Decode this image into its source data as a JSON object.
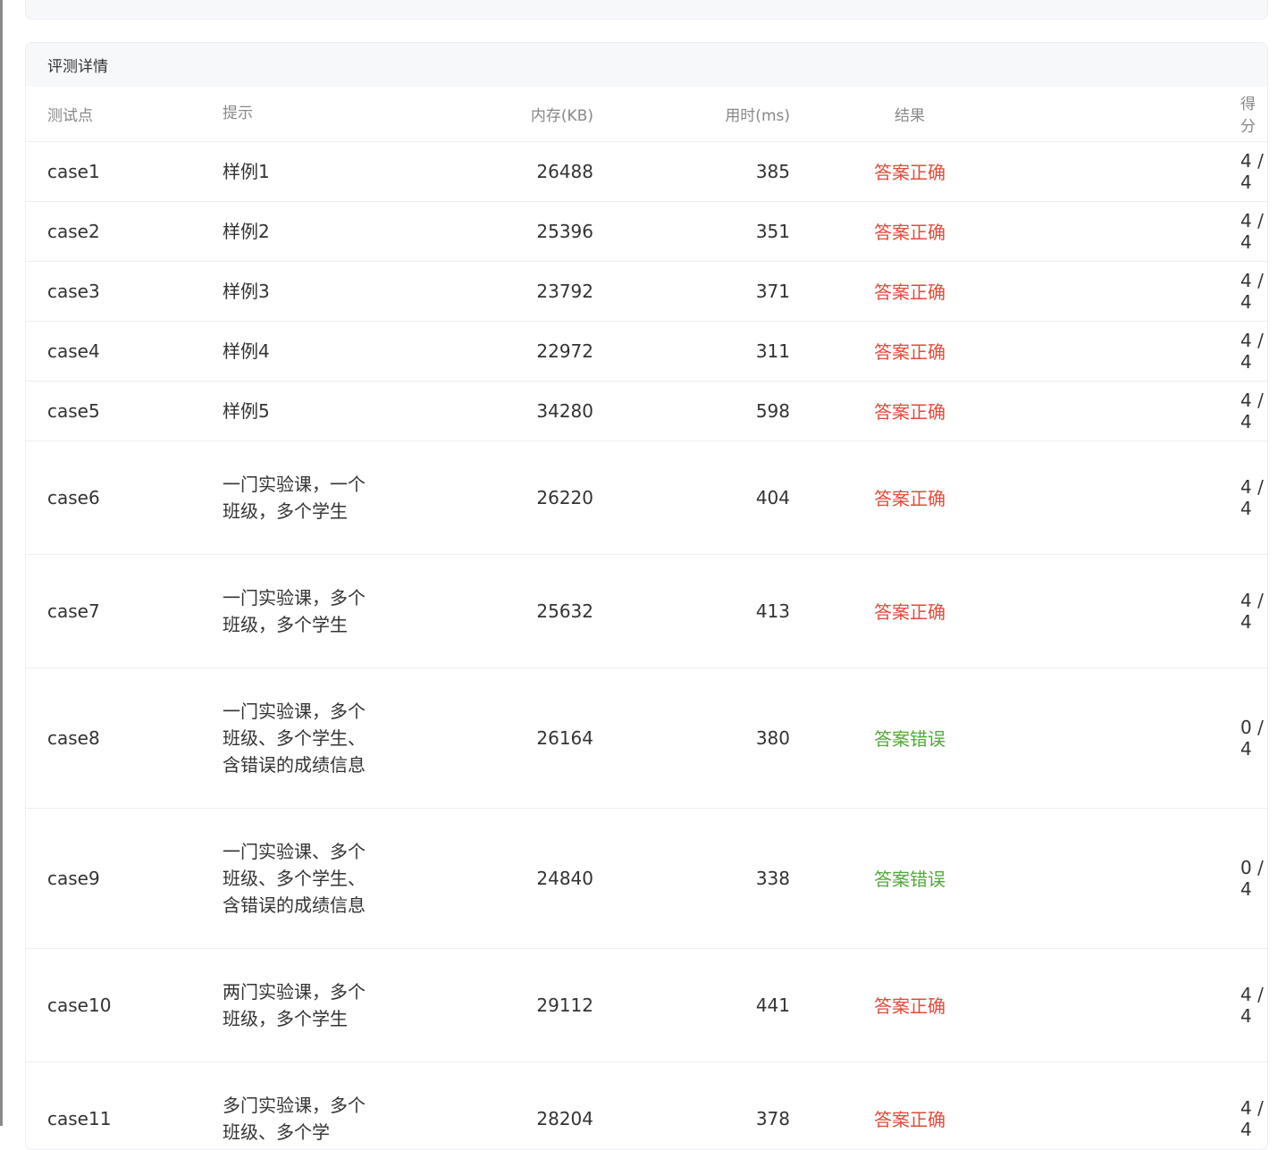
{
  "panel": {
    "title": "评测详情"
  },
  "columns": {
    "case": "测试点",
    "hint": "提示",
    "memory": "内存(KB)",
    "time": "用时(ms)",
    "result": "结果",
    "score": "得分"
  },
  "colors": {
    "correct": "#e04b3a",
    "wrong": "#52a83a"
  },
  "rows": [
    {
      "case": "case1",
      "hint": "样例1",
      "memory": "26488",
      "time": "385",
      "result": "答案正确",
      "score": "4 / 4"
    },
    {
      "case": "case2",
      "hint": "样例2",
      "memory": "25396",
      "time": "351",
      "result": "答案正确",
      "score": "4 / 4"
    },
    {
      "case": "case3",
      "hint": "样例3",
      "memory": "23792",
      "time": "371",
      "result": "答案正确",
      "score": "4 / 4"
    },
    {
      "case": "case4",
      "hint": "样例4",
      "memory": "22972",
      "time": "311",
      "result": "答案正确",
      "score": "4 / 4"
    },
    {
      "case": "case5",
      "hint": "样例5",
      "memory": "34280",
      "time": "598",
      "result": "答案正确",
      "score": "4 / 4"
    },
    {
      "case": "case6",
      "hint": "一门实验课，一个班级，多个学生",
      "memory": "26220",
      "time": "404",
      "result": "答案正确",
      "score": "4 / 4"
    },
    {
      "case": "case7",
      "hint": "一门实验课，多个班级，多个学生",
      "memory": "25632",
      "time": "413",
      "result": "答案正确",
      "score": "4 / 4"
    },
    {
      "case": "case8",
      "hint": "一门实验课，多个班级、多个学生、含错误的成绩信息",
      "memory": "26164",
      "time": "380",
      "result": "答案错误",
      "score": "0 / 4"
    },
    {
      "case": "case9",
      "hint": "一门实验课、多个班级、多个学生、含错误的成绩信息",
      "memory": "24840",
      "time": "338",
      "result": "答案错误",
      "score": "0 / 4"
    },
    {
      "case": "case10",
      "hint": "两门实验课，多个班级，多个学生",
      "memory": "29112",
      "time": "441",
      "result": "答案正确",
      "score": "4 / 4"
    },
    {
      "case": "case11",
      "hint": "多门实验课，多个班级、多个学",
      "memory": "28204",
      "time": "378",
      "result": "答案正确",
      "score": "4 / 4"
    }
  ]
}
